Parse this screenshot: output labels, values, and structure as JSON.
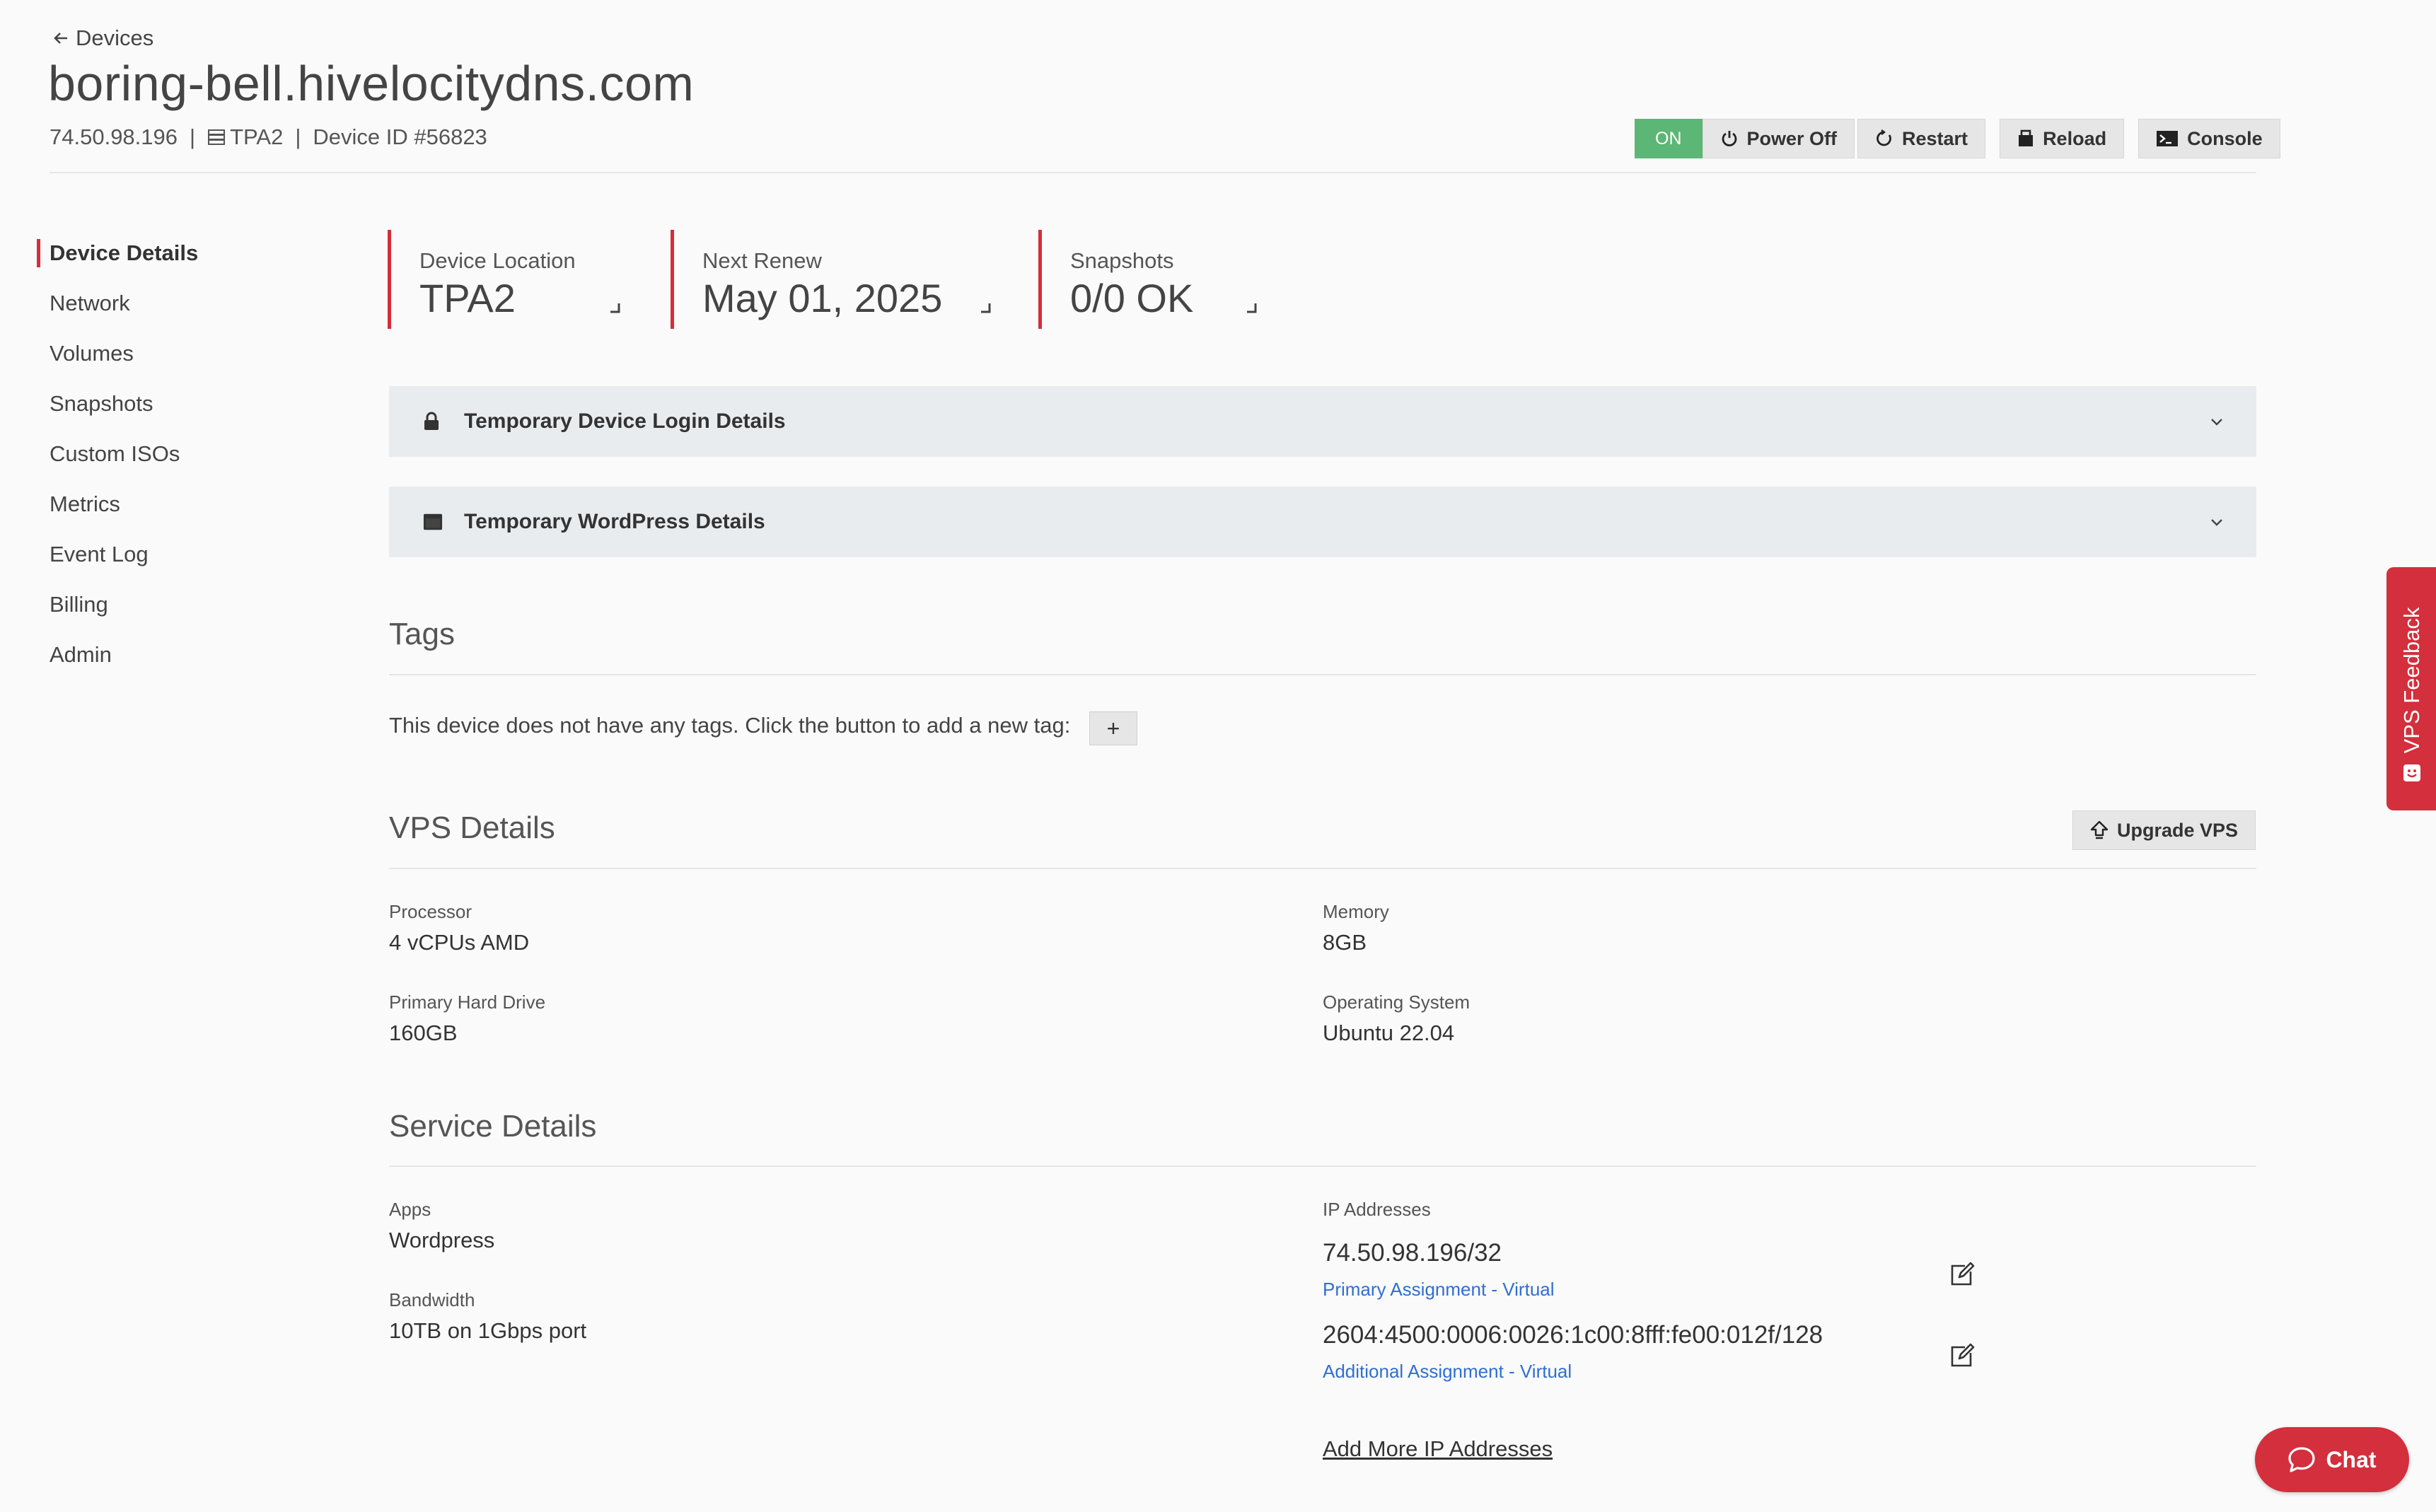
{
  "header": {
    "back_label": "Devices",
    "title": "boring-bell.hivelocitydns.com",
    "ip": "74.50.98.196",
    "location": "TPA2",
    "device_id": "Device ID #56823",
    "separator": "|"
  },
  "power": {
    "status": "ON",
    "buttons": {
      "power_off": "Power Off",
      "restart": "Restart",
      "reload": "Reload",
      "console": "Console"
    }
  },
  "sidebar": {
    "items": [
      {
        "label": "Device Details",
        "active": true
      },
      {
        "label": "Network"
      },
      {
        "label": "Volumes"
      },
      {
        "label": "Snapshots"
      },
      {
        "label": "Custom ISOs"
      },
      {
        "label": "Metrics"
      },
      {
        "label": "Event Log"
      },
      {
        "label": "Billing"
      },
      {
        "label": "Admin"
      }
    ]
  },
  "stats": [
    {
      "label": "Device Location",
      "value": "TPA2"
    },
    {
      "label": "Next Renew",
      "value": "May 01, 2025"
    },
    {
      "label": "Snapshots",
      "value": "0/0 OK"
    }
  ],
  "accordions": [
    {
      "title": "Temporary Device Login Details",
      "icon": "lock-icon"
    },
    {
      "title": "Temporary WordPress Details",
      "icon": "browser-window-icon"
    }
  ],
  "tags": {
    "title": "Tags",
    "empty_text": "This device does not have any tags. Click the button to add a new tag:",
    "add_label": "+"
  },
  "vps": {
    "title": "VPS Details",
    "upgrade_label": "Upgrade VPS",
    "fields": {
      "processor": {
        "label": "Processor",
        "value": "4 vCPUs AMD"
      },
      "memory": {
        "label": "Memory",
        "value": "8GB"
      },
      "drive": {
        "label": "Primary Hard Drive",
        "value": "160GB"
      },
      "os": {
        "label": "Operating System",
        "value": "Ubuntu 22.04"
      }
    }
  },
  "service": {
    "title": "Service Details",
    "apps": {
      "label": "Apps",
      "value": "Wordpress"
    },
    "bandwidth": {
      "label": "Bandwidth",
      "value": "10TB on 1Gbps port"
    },
    "ip_label": "IP Addresses",
    "ips": [
      {
        "address": "74.50.98.196/32",
        "assignment": "Primary Assignment - Virtual"
      },
      {
        "address": "2604:4500:0006:0026:1c00:8fff:fe00:012f/128",
        "assignment": "Additional Assignment - Virtual"
      }
    ],
    "add_more": "Add More IP Addresses"
  },
  "widgets": {
    "feedback": "VPS Feedback",
    "chat": "Chat"
  },
  "colors": {
    "accent_red": "#d62d3b",
    "on_green": "#5cb675",
    "link_blue": "#2f6fd0",
    "accordion_bg": "#e9ecef"
  }
}
